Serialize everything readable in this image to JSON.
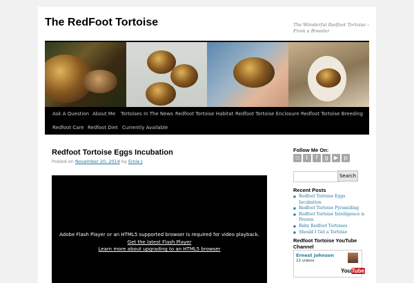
{
  "site": {
    "title": "The RedFoot Tortoise",
    "description": "The Wonderful Redfoot Tortoise – From a Breeder"
  },
  "nav": {
    "items": [
      {
        "label": "Ask A Question"
      },
      {
        "label": "About Me"
      },
      {
        "label": "Tortoises In The News"
      },
      {
        "label": "Redfoot Tortoise Habitat"
      },
      {
        "label": "Redfoot Tortoise Enclosure"
      },
      {
        "label": "Redfoot Tortoise Breeding"
      },
      {
        "label": "Redfoot Care"
      },
      {
        "label": "Redfoot Diet"
      },
      {
        "label": "Currently Available"
      }
    ]
  },
  "post": {
    "title": "Redfoot Tortoise Eggs Incubation",
    "posted_on": "Posted on",
    "date": "November 20, 2014",
    "by": "by",
    "author": "Ernie J"
  },
  "video": {
    "message": "Adobe Flash Player or an HTML5 supported browser is required for video playback.",
    "link1": "Get the latest Flash Player",
    "link2": "Learn more about upgrading to an HTML5 browser"
  },
  "sidebar": {
    "follow_title": "Follow Me On:",
    "social_icons": [
      "rss-icon",
      "twitter-icon",
      "facebook-icon",
      "google-plus-icon",
      "youtube-icon",
      "pinterest-icon"
    ],
    "search": {
      "placeholder": "",
      "button": "Search"
    },
    "recent_title": "Recent Posts",
    "recent_posts": [
      "Redfoot Tortoise Eggs Incubation",
      "Redfoot Tortoise Pyramiding",
      "Redfoot Tortoise Intelligence is Proven",
      "Baby Redfoot Tortoises",
      "Should I Get a Tortoise"
    ],
    "youtube_title": "Redfoot Tortoise YouTube Channel",
    "youtube": {
      "channel_name": "Ernest Johnson",
      "video_count": "22 videos",
      "logo_you": "You",
      "logo_tube": "Tube"
    }
  },
  "colors": {
    "link": "#21759b",
    "nav_bg": "#000000",
    "page_bg": "#f1f1f1"
  }
}
